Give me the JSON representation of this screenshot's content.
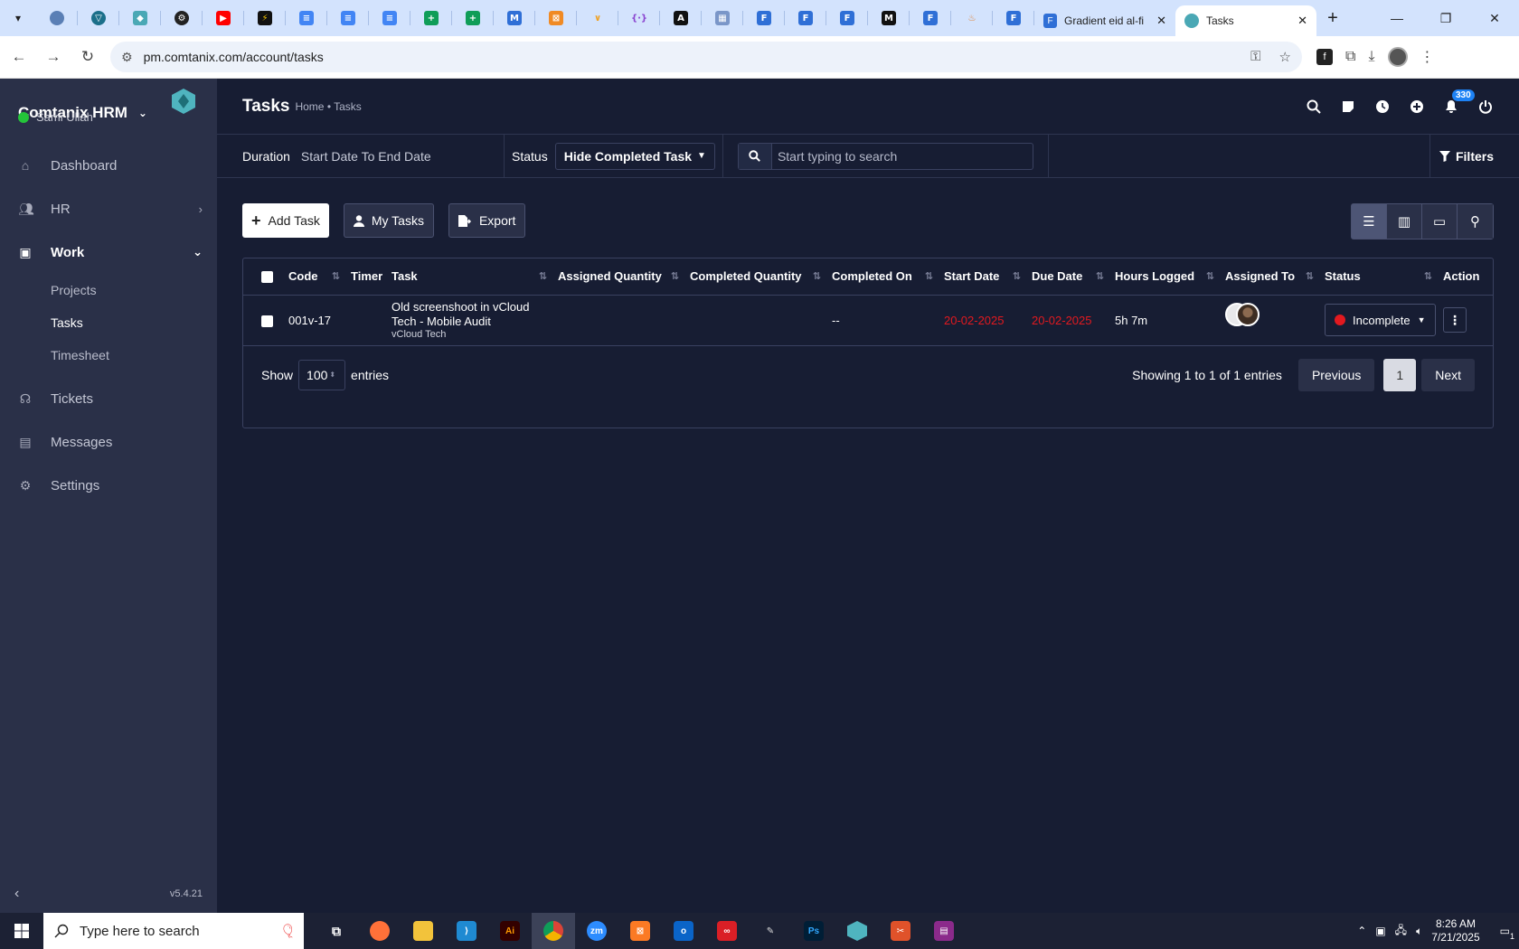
{
  "browser": {
    "tabs": [
      {
        "label": "Gradient eid al-fi",
        "active": false
      },
      {
        "label": "Tasks",
        "active": true
      }
    ],
    "url": "pm.comtanix.com/account/tasks"
  },
  "sidebar": {
    "company": "Comtanix HRM",
    "user": "Sami Ullah",
    "nav": {
      "dashboard": "Dashboard",
      "hr": "HR",
      "work": "Work",
      "projects": "Projects",
      "tasks": "Tasks",
      "timesheet": "Timesheet",
      "tickets": "Tickets",
      "messages": "Messages",
      "settings": "Settings"
    },
    "version": "v5.4.21"
  },
  "header": {
    "title": "Tasks",
    "breadcrumb": "Home • Tasks",
    "notification_count": "330"
  },
  "filters": {
    "duration_label": "Duration",
    "duration_value": "Start Date To End Date",
    "status_label": "Status",
    "status_value": "Hide Completed Task",
    "search_placeholder": "Start typing to search",
    "filters_label": "Filters"
  },
  "actions": {
    "add_task": "Add Task",
    "my_tasks": "My Tasks",
    "export": "Export"
  },
  "table": {
    "columns": {
      "code": "Code",
      "timer": "Timer",
      "task": "Task",
      "assigned_qty": "Assigned Quantity",
      "completed_qty": "Completed Quantity",
      "completed_on": "Completed On",
      "start_date": "Start Date",
      "due_date": "Due Date",
      "hours_logged": "Hours Logged",
      "assigned_to": "Assigned To",
      "status": "Status",
      "action": "Action"
    },
    "rows": [
      {
        "code": "001v-17",
        "timer": "",
        "task": "Old screenshoot in vCloud Tech - Mobile Audit",
        "project": "vCloud Tech",
        "assigned_qty": "",
        "completed_qty": "",
        "completed_on": "--",
        "start_date": "20-02-2025",
        "due_date": "20-02-2025",
        "hours_logged": "5h 7m",
        "status": "Incomplete"
      }
    ],
    "footer": {
      "show": "Show",
      "entries_value": "100",
      "entries": "entries",
      "showing": "Showing 1 to 1 of 1 entries",
      "previous": "Previous",
      "page": "1",
      "next": "Next"
    }
  },
  "taskbar": {
    "search_placeholder": "Type here to search",
    "time": "8:26 AM",
    "date": "7/21/2025",
    "notification_count": "1"
  },
  "colors": {
    "sidebar_bg": "#2a3048",
    "main_bg": "#171d33",
    "danger": "#e2191f",
    "online": "#24c43a",
    "badge": "#1d82f5"
  }
}
